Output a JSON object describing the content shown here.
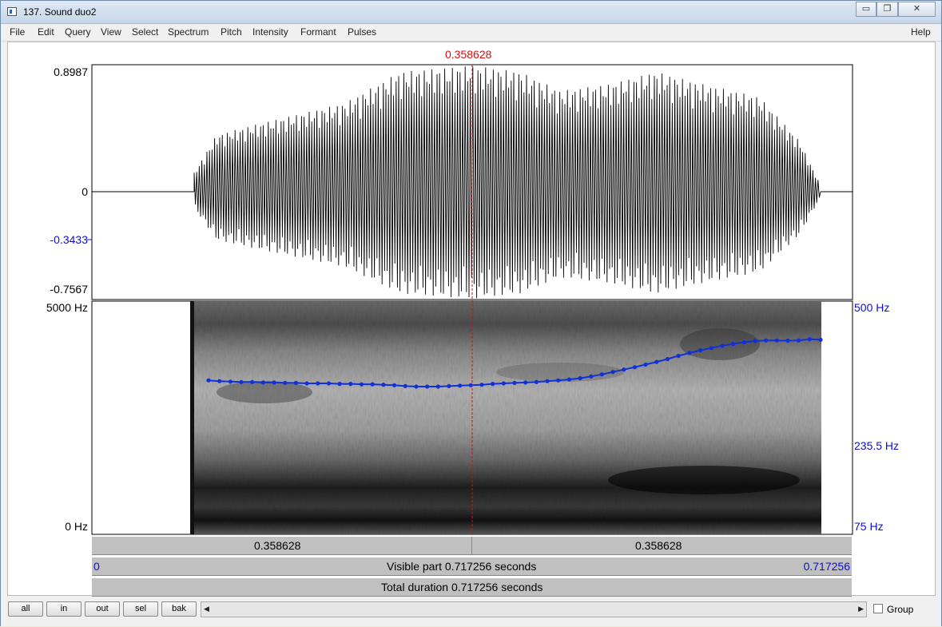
{
  "window": {
    "title": "137. Sound duo2",
    "min_label": "▭",
    "restore_label": "❐",
    "close_label": "✕"
  },
  "menu": [
    "File",
    "Edit",
    "Query",
    "View",
    "Select",
    "Spectrum",
    "Pitch",
    "Intensity",
    "Formant",
    "Pulses"
  ],
  "help_label": "Help",
  "cursor_time": "0.358628",
  "waveform": {
    "y_max": "0.8987",
    "y_zero": "0",
    "y_marked": "-0.3433",
    "y_min": "-0.7567"
  },
  "spectrogram": {
    "freq_max": "5000 Hz",
    "freq_min": "0 Hz"
  },
  "pitch": {
    "max": "500 Hz",
    "value": "235.5 Hz",
    "min": "75 Hz"
  },
  "pitch_track_hz": [
    266,
    264,
    263,
    262,
    262,
    261,
    261,
    260,
    260,
    259,
    259,
    259,
    258,
    258,
    257,
    257,
    256,
    255,
    253,
    252,
    252,
    252,
    253,
    254,
    255,
    256,
    258,
    259,
    260,
    261,
    262,
    264,
    266,
    268,
    271,
    275,
    280,
    286,
    292,
    298,
    305,
    312,
    320,
    329,
    337,
    345,
    352,
    359,
    365,
    370,
    374,
    376,
    376,
    375,
    376,
    380,
    378
  ],
  "time_bars": {
    "left_segment": "0.358628",
    "right_segment": "0.358628",
    "visible_start": "0",
    "visible_text": "Visible part 0.717256 seconds",
    "visible_end": "0.717256",
    "total_text": "Total duration 0.717256 seconds"
  },
  "buttons": {
    "all": "all",
    "in": "in",
    "out": "out",
    "sel": "sel",
    "bak": "bak"
  },
  "scroll_left": "◀",
  "scroll_right": "▶",
  "group_label": "Group",
  "colors": {
    "cursor": "#d01010",
    "pitch": "#1030d8",
    "axis_blue": "#1010c0"
  }
}
